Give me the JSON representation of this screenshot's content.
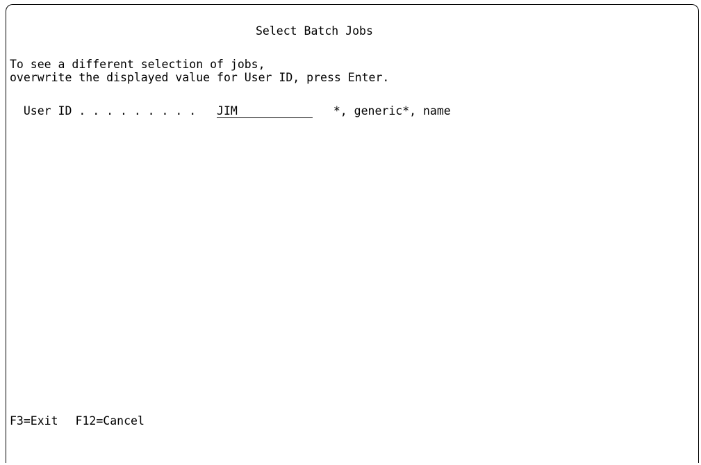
{
  "window": {
    "title": "Select Batch Jobs"
  },
  "instructions": {
    "line1": "To see a different selection of jobs,",
    "line2": "overwrite the displayed value for User ID, press Enter."
  },
  "user_id_field": {
    "label": "User ID . . . . . . . . .",
    "value": "JIM",
    "allowed_values": "*, generic*, name"
  },
  "function_keys": [
    {
      "label": "F3=Exit"
    },
    {
      "label": "F12=Cancel"
    }
  ]
}
